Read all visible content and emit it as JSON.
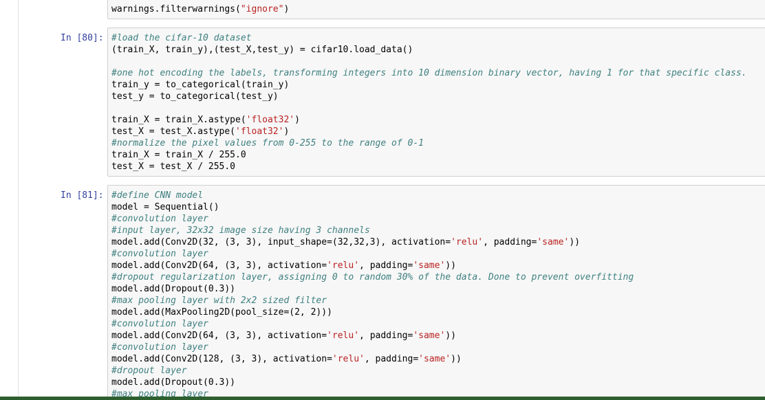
{
  "cells": [
    {
      "prompt": "",
      "lines": [
        {
          "parts": [
            {
              "t": "warnings.filterwarnings(",
              "c": ""
            },
            {
              "t": "\"ignore\"",
              "c": "st"
            },
            {
              "t": ")",
              "c": ""
            }
          ]
        }
      ]
    },
    {
      "prompt": "In [80]:",
      "lines": [
        {
          "parts": [
            {
              "t": "#load the cifar-10 dataset",
              "c": "cm"
            }
          ]
        },
        {
          "parts": [
            {
              "t": "(train_X, train_y),(test_X,test_y) = cifar10.load_data()",
              "c": ""
            }
          ]
        },
        {
          "parts": [
            {
              "t": "",
              "c": ""
            }
          ]
        },
        {
          "parts": [
            {
              "t": "#one hot encoding the labels, transforming integers into 10 dimension binary vector, having 1 for that specific class.",
              "c": "cm"
            }
          ]
        },
        {
          "parts": [
            {
              "t": "train_y = to_categorical(train_y)",
              "c": ""
            }
          ]
        },
        {
          "parts": [
            {
              "t": "test_y = to_categorical(test_y)",
              "c": ""
            }
          ]
        },
        {
          "parts": [
            {
              "t": "",
              "c": ""
            }
          ]
        },
        {
          "parts": [
            {
              "t": "train_X = train_X.astype(",
              "c": ""
            },
            {
              "t": "'float32'",
              "c": "st"
            },
            {
              "t": ")",
              "c": ""
            }
          ]
        },
        {
          "parts": [
            {
              "t": "test_X = test_X.astype(",
              "c": ""
            },
            {
              "t": "'float32'",
              "c": "st"
            },
            {
              "t": ")",
              "c": ""
            }
          ]
        },
        {
          "parts": [
            {
              "t": "#normalize the pixel values from 0-255 to the range of 0-1",
              "c": "cm"
            }
          ]
        },
        {
          "parts": [
            {
              "t": "train_X = train_X / 255.0",
              "c": ""
            }
          ]
        },
        {
          "parts": [
            {
              "t": "test_X = test_X / 255.0",
              "c": ""
            }
          ]
        }
      ]
    },
    {
      "prompt": "In [81]:",
      "lines": [
        {
          "parts": [
            {
              "t": "#define CNN model",
              "c": "cm"
            }
          ]
        },
        {
          "parts": [
            {
              "t": "model = Sequential()",
              "c": ""
            }
          ]
        },
        {
          "parts": [
            {
              "t": "#convolution layer",
              "c": "cm"
            }
          ]
        },
        {
          "parts": [
            {
              "t": "#input layer, 32x32 image size having 3 channels",
              "c": "cm"
            }
          ]
        },
        {
          "parts": [
            {
              "t": "model.add(Conv2D(32, (3, 3), input_shape=(32,32,3), activation=",
              "c": ""
            },
            {
              "t": "'relu'",
              "c": "st"
            },
            {
              "t": ", padding=",
              "c": ""
            },
            {
              "t": "'same'",
              "c": "st"
            },
            {
              "t": "))",
              "c": ""
            }
          ]
        },
        {
          "parts": [
            {
              "t": "#convolution layer",
              "c": "cm"
            }
          ]
        },
        {
          "parts": [
            {
              "t": "model.add(Conv2D(64, (3, 3), activation=",
              "c": ""
            },
            {
              "t": "'relu'",
              "c": "st"
            },
            {
              "t": ", padding=",
              "c": ""
            },
            {
              "t": "'same'",
              "c": "st"
            },
            {
              "t": "))",
              "c": ""
            }
          ]
        },
        {
          "parts": [
            {
              "t": "#dropout regularization layer, assigning 0 to random 30% of the data. Done to prevent overfitting",
              "c": "cm"
            }
          ]
        },
        {
          "parts": [
            {
              "t": "model.add(Dropout(0.3))",
              "c": ""
            }
          ]
        },
        {
          "parts": [
            {
              "t": "#max pooling layer with 2x2 sized filter",
              "c": "cm"
            }
          ]
        },
        {
          "parts": [
            {
              "t": "model.add(MaxPooling2D(pool_size=(2, 2)))",
              "c": ""
            }
          ]
        },
        {
          "parts": [
            {
              "t": "#convolution layer",
              "c": "cm"
            }
          ]
        },
        {
          "parts": [
            {
              "t": "model.add(Conv2D(64, (3, 3), activation=",
              "c": ""
            },
            {
              "t": "'relu'",
              "c": "st"
            },
            {
              "t": ", padding=",
              "c": ""
            },
            {
              "t": "'same'",
              "c": "st"
            },
            {
              "t": "))",
              "c": ""
            }
          ]
        },
        {
          "parts": [
            {
              "t": "#convolution layer",
              "c": "cm"
            }
          ]
        },
        {
          "parts": [
            {
              "t": "model.add(Conv2D(128, (3, 3), activation=",
              "c": ""
            },
            {
              "t": "'relu'",
              "c": "st"
            },
            {
              "t": ", padding=",
              "c": ""
            },
            {
              "t": "'same'",
              "c": "st"
            },
            {
              "t": "))",
              "c": ""
            }
          ]
        },
        {
          "parts": [
            {
              "t": "#dropout layer",
              "c": "cm"
            }
          ]
        },
        {
          "parts": [
            {
              "t": "model.add(Dropout(0.3))",
              "c": ""
            }
          ]
        },
        {
          "parts": [
            {
              "t": "#max pooling layer",
              "c": "cm"
            }
          ]
        }
      ]
    }
  ],
  "colors": {
    "prompt": "#303f9f",
    "comment": "#408080",
    "string": "#ba2121",
    "cell_background": "#f7f7f7",
    "cell_border": "#cfcfcf",
    "bottom_bar": "#2d5f2e"
  }
}
